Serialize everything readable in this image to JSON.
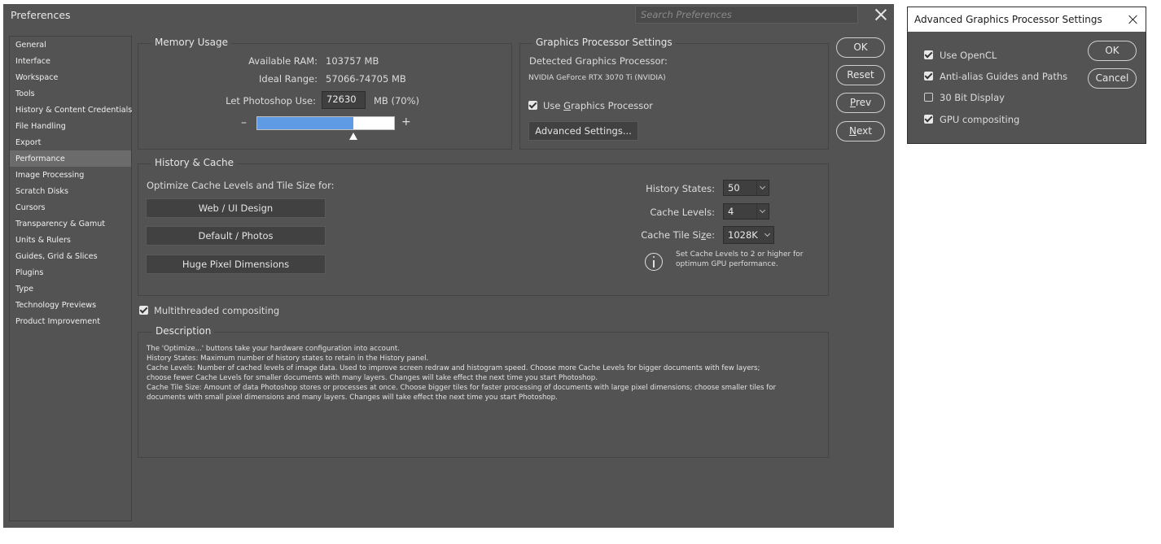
{
  "window": {
    "title": "Preferences",
    "search_placeholder": "Search Preferences"
  },
  "sidebar": {
    "items": [
      {
        "label": "General"
      },
      {
        "label": "Interface"
      },
      {
        "label": "Workspace"
      },
      {
        "label": "Tools"
      },
      {
        "label": "History & Content Credentials"
      },
      {
        "label": "File Handling"
      },
      {
        "label": "Export"
      },
      {
        "label": "Performance",
        "active": true
      },
      {
        "label": "Image Processing"
      },
      {
        "label": "Scratch Disks"
      },
      {
        "label": "Cursors"
      },
      {
        "label": "Transparency & Gamut"
      },
      {
        "label": "Units & Rulers"
      },
      {
        "label": "Guides, Grid & Slices"
      },
      {
        "label": "Plugins"
      },
      {
        "label": "Type"
      },
      {
        "label": "Technology Previews"
      },
      {
        "label": "Product Improvement"
      }
    ]
  },
  "memory": {
    "title": "Memory Usage",
    "available_label": "Available RAM:",
    "available_value": "103757 MB",
    "ideal_label": "Ideal Range:",
    "ideal_value": "57066-74705 MB",
    "let_label": "Let Photoshop Use:",
    "let_value": "72630",
    "let_suffix": "MB (70%)",
    "minus": "–",
    "plus": "+",
    "slider_fraction": 0.7
  },
  "gpu": {
    "title": "Graphics Processor Settings",
    "detected_label": "Detected Graphics Processor:",
    "detected_value": "NVIDIA GeForce RTX 3070 Ti (NVIDIA)",
    "use_gpu_pre": "Use ",
    "use_gpu_u": "G",
    "use_gpu_post": "raphics Processor",
    "use_gpu_checked": true,
    "advanced_button": "Advanced Settings..."
  },
  "buttons": {
    "ok": "OK",
    "reset": "Reset",
    "prev_u": "P",
    "prev_rest": "rev",
    "next_u": "N",
    "next_rest": "ext"
  },
  "history": {
    "title": "History & Cache",
    "optimize_label": "Optimize Cache Levels and Tile Size for:",
    "opt_buttons": [
      "Web / UI Design",
      "Default / Photos",
      "Huge Pixel Dimensions"
    ],
    "states_label": "History States:",
    "states_value": "50",
    "levels_label": "Cache Levels:",
    "levels_value": "4",
    "tile_label_pre": "Cache Tile Si",
    "tile_label_u": "z",
    "tile_label_post": "e:",
    "tile_value": "1028K",
    "hint_line1": "Set Cache Levels to 2 or higher for",
    "hint_line2": "optimum GPU performance."
  },
  "multithreaded": {
    "label": "Multithreaded compositing",
    "checked": true
  },
  "description": {
    "title": "Description",
    "lines": [
      "The 'Optimize...' buttons take your hardware configuration into account.",
      "History States: Maximum number of history states to retain in the History panel.",
      "Cache Levels: Number of cached levels of image data.  Used to improve screen redraw and histogram speed.  Choose more Cache Levels for bigger documents with few layers;",
      "choose fewer Cache Levels for smaller documents with many layers. Changes will take effect the next time you start Photoshop.",
      "Cache Tile Size: Amount of data Photoshop stores or processes at once. Choose bigger tiles for faster processing of documents with large pixel dimensions; choose smaller tiles for",
      "documents with small pixel dimensions and many layers. Changes will take effect the next time you start Photoshop."
    ]
  },
  "advanced_dialog": {
    "title": "Advanced Graphics Processor Settings",
    "options": [
      {
        "label": "Use OpenCL",
        "checked": true
      },
      {
        "label": "Anti-alias Guides and Paths",
        "checked": true
      },
      {
        "label": "30 Bit Display",
        "checked": false
      },
      {
        "label": "GPU compositing",
        "checked": true
      }
    ],
    "ok": "OK",
    "cancel": "Cancel"
  }
}
